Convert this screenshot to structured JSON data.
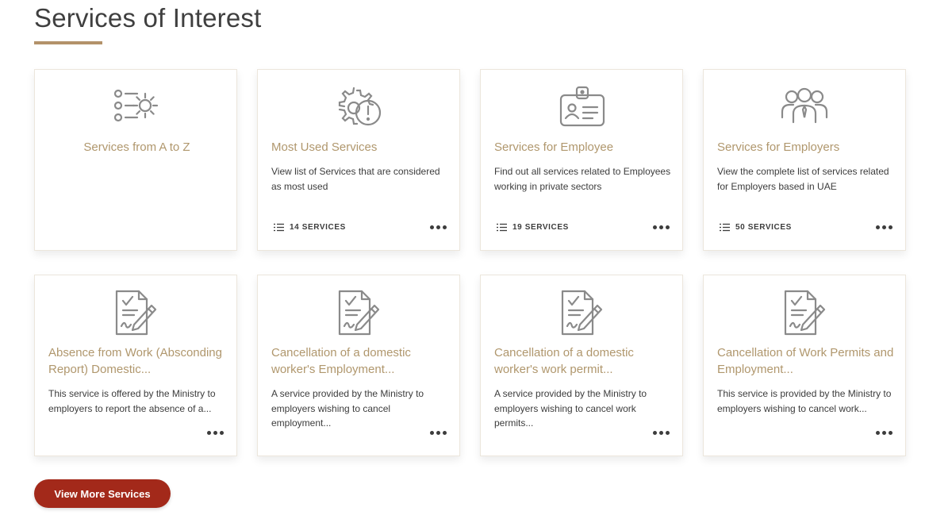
{
  "header": {
    "title": "Services of Interest"
  },
  "colors": {
    "accent": "#b3926a",
    "card_title": "#b0976d",
    "button": "#a3291a",
    "icon": "#8a8a8a"
  },
  "cards": [
    {
      "title": "Services from A to Z",
      "desc": "",
      "count": "",
      "icon": "list-gear-icon"
    },
    {
      "title": "Most Used Services",
      "desc": "View list of Services that are considered as most used",
      "count": "14 SERVICES",
      "icon": "gear-alert-icon"
    },
    {
      "title": "Services for Employee",
      "desc": "Find out all services related to Employees working in private sectors",
      "count": "19 SERVICES",
      "icon": "id-badge-icon"
    },
    {
      "title": "Services for Employers",
      "desc": "View the complete list of services related for Employers based in UAE",
      "count": "50 SERVICES",
      "icon": "users-group-icon"
    },
    {
      "title": "Absence from Work (Absconding Report) Domestic...",
      "desc": "This service is offered by the Ministry to employers to report the absence of a...",
      "icon": "document-sign-icon"
    },
    {
      "title": "Cancellation of a domestic worker's Employment...",
      "desc": "A service provided by the Ministry to employers wishing to cancel employment...",
      "icon": "document-sign-icon"
    },
    {
      "title": "Cancellation of a domestic worker's work permit...",
      "desc": "A service provided by the Ministry to employers wishing to cancel work permits...",
      "icon": "document-sign-icon"
    },
    {
      "title": "Cancellation of Work Permits and Employment...",
      "desc": "This service is provided by the Ministry to employers wishing to cancel work...",
      "icon": "document-sign-icon"
    }
  ],
  "actions": {
    "view_more": "View More Services"
  }
}
